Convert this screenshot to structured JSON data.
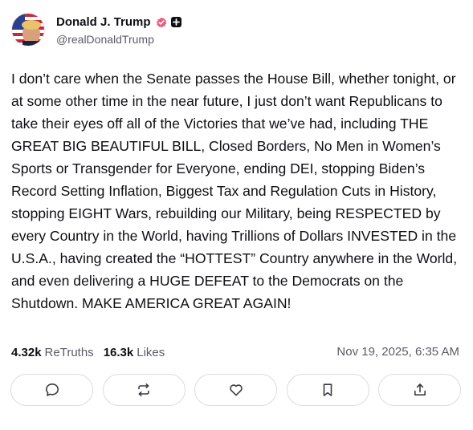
{
  "post": {
    "author": {
      "display_name": "Donald J. Trump",
      "handle": "@realDonaldTrump",
      "verified_color": "#e95d7a"
    },
    "text": "I don’t care when the Senate passes the House Bill, whether tonight, or at some other time in the near future, I just don’t want Republicans to take their eyes off all of the Victories that we’ve had, including THE GREAT BIG BEAUTIFUL BILL, Closed Borders, No Men in Women’s Sports or Transgender for Everyone, ending DEI, stopping Biden’s Record Setting Inflation, Biggest Tax and Regulation Cuts in History, stopping EIGHT Wars, rebuilding our Military, being RESPECTED by every Country in the World, having Trillions of Dollars INVESTED in the U.S.A., having created the “HOTTEST” Country anywhere in the World, and even delivering a HUGE DEFEAT to the Democrats on the Shutdown. MAKE AMERICA GREAT AGAIN!",
    "stats": {
      "retruths_count": "4.32k",
      "retruths_label": "ReTruths",
      "likes_count": "16.3k",
      "likes_label": "Likes"
    },
    "timestamp": "Nov 19, 2025, 6:35 AM",
    "actions": [
      {
        "icon": "comment-icon"
      },
      {
        "icon": "retruth-icon"
      },
      {
        "icon": "heart-icon"
      },
      {
        "icon": "bookmark-icon"
      },
      {
        "icon": "share-icon"
      }
    ]
  }
}
